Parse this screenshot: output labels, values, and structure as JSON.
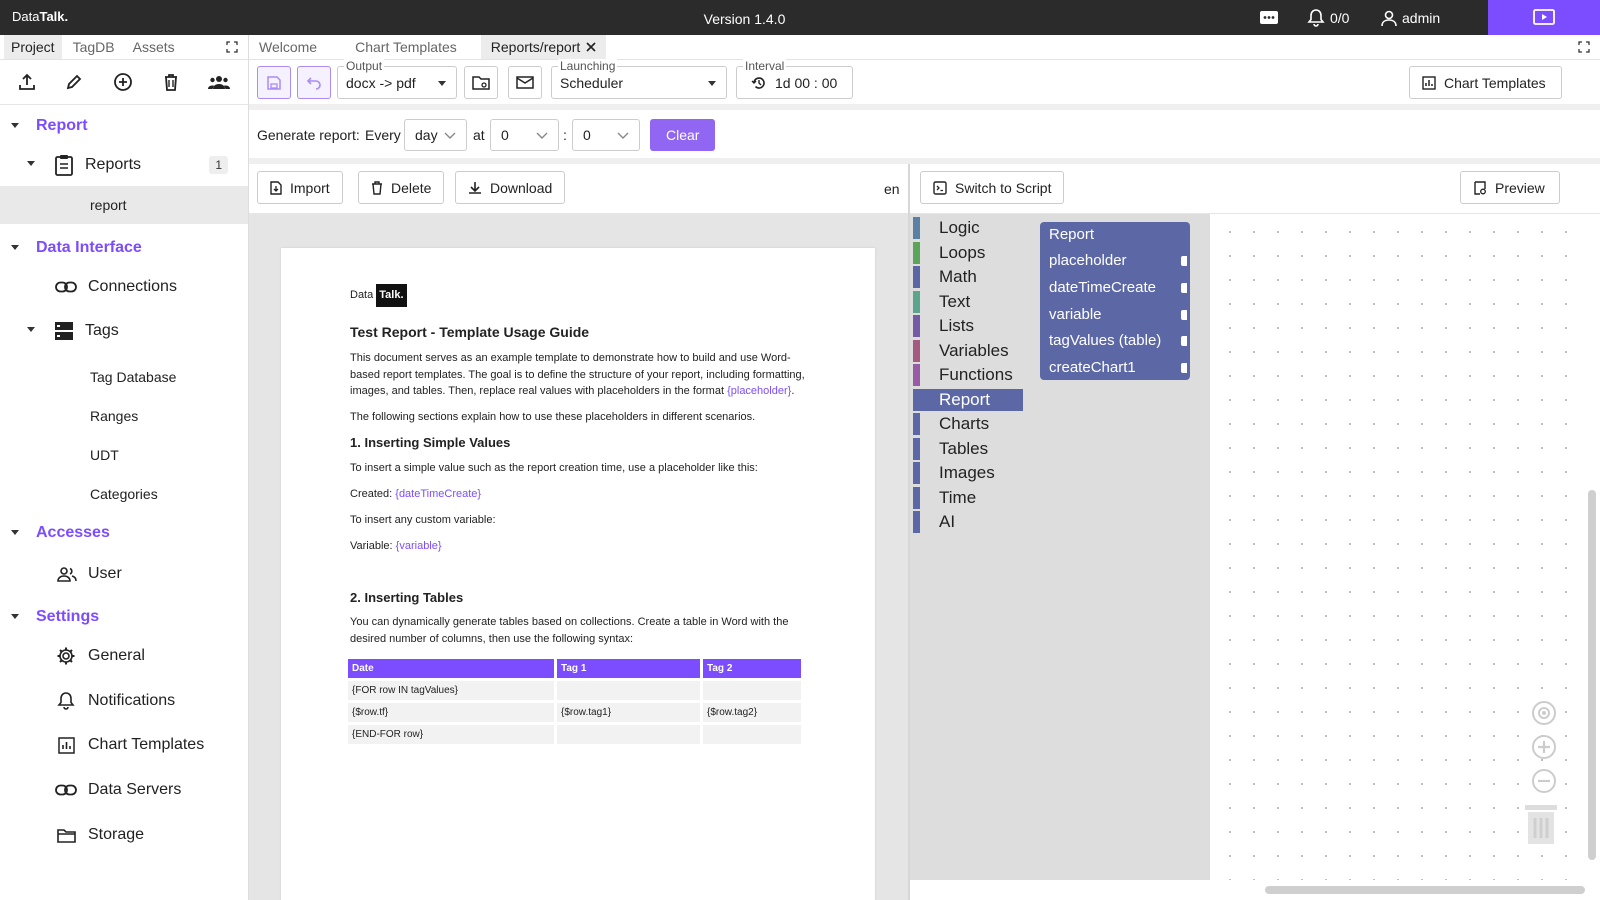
{
  "app": {
    "brand_light": "Data",
    "brand_bold": "Talk.",
    "version": "Version 1.4.0",
    "alarms": "0/0",
    "user": "admin"
  },
  "left": {
    "tabs": [
      "Project",
      "TagDB",
      "Assets"
    ],
    "tree": {
      "report": "Report",
      "reports": "Reports",
      "reports_count": "1",
      "report_item": "report",
      "data_interface": "Data Interface",
      "connections": "Connections",
      "tags": "Tags",
      "tag_database": "Tag Database",
      "ranges": "Ranges",
      "udt": "UDT",
      "categories": "Categories",
      "accesses": "Accesses",
      "user": "User",
      "settings": "Settings",
      "general": "General",
      "notifications": "Notifications",
      "chart_templates": "Chart Templates",
      "data_servers": "Data Servers",
      "storage": "Storage"
    }
  },
  "tabs": [
    "Welcome",
    "Chart Templates",
    "Reports/report"
  ],
  "toolbar": {
    "output_label": "Output",
    "output_value": "docx -> pdf",
    "launching_label": "Launching",
    "launching_value": "Scheduler",
    "interval_label": "Interval",
    "interval_value": "1d 00 : 00",
    "chart_templates_button": "Chart Templates"
  },
  "generate": {
    "label": "Generate report:",
    "every": "Every",
    "period": "day",
    "at": "at",
    "hour": "0",
    "sep": ":",
    "minute": "0",
    "clear": "Clear"
  },
  "docbar": {
    "import": "Import",
    "delete": "Delete",
    "download": "Download",
    "lang": "en"
  },
  "document": {
    "logo_light": "Data",
    "logo_bold": "Talk.",
    "title": "Test Report - Template Usage Guide",
    "intro": "This document serves as an example template to demonstrate how to build and use Word-based report templates. The goal is to define the structure of your report, including formatting, images, and tables. Then, replace real values with placeholders in the format",
    "intro_ph": "{placeholder}",
    "following": "The following sections explain how to use these placeholders in different scenarios.",
    "s1": "1. Inserting Simple Values",
    "s1_text": "To insert a simple value such as the report creation time, use a placeholder like this:",
    "created_label": "Created:",
    "created_ph": "{dateTimeCreate}",
    "custom": "To insert any custom variable:",
    "variable_label": "Variable:",
    "variable_ph": "{variable}",
    "s2": "2. Inserting Tables",
    "s2_text": "You can dynamically generate tables based on collections. Create a table in Word with the desired number of columns, then use the following syntax:",
    "table_headers": [
      "Date",
      "Tag 1",
      "Tag 2"
    ],
    "table_rows": [
      [
        "{FOR row IN tagValues}",
        "",
        ""
      ],
      [
        "{$row.tf}",
        "{$row.tag1}",
        "{$row.tag2}"
      ],
      [
        "{END-FOR row}",
        "",
        ""
      ]
    ]
  },
  "blockly": {
    "switch_button": "Switch to Script",
    "preview_button": "Preview",
    "categories": [
      {
        "label": "Logic",
        "color": "#5b80a5"
      },
      {
        "label": "Loops",
        "color": "#5ba55b"
      },
      {
        "label": "Math",
        "color": "#5b67a5"
      },
      {
        "label": "Text",
        "color": "#5ba58c"
      },
      {
        "label": "Lists",
        "color": "#745ba5"
      },
      {
        "label": "Variables",
        "color": "#a55b80"
      },
      {
        "label": "Functions",
        "color": "#995ba5"
      },
      {
        "label": "Report",
        "color": "#5c68a6"
      },
      {
        "label": "Charts",
        "color": "#5c68a6"
      },
      {
        "label": "Tables",
        "color": "#5c68a6"
      },
      {
        "label": "Images",
        "color": "#5c68a6"
      },
      {
        "label": "Time",
        "color": "#5c68a6"
      },
      {
        "label": "AI",
        "color": "#5c68a6"
      }
    ],
    "selected_category": "Report",
    "flyout": [
      "Report",
      "placeholder",
      "dateTimeCreate",
      "variable",
      "tagValues (table)",
      "createChart1"
    ]
  },
  "colors": {
    "accent": "#7c4dff",
    "block": "#5c68a6",
    "topbar": "#2b2b2b"
  }
}
